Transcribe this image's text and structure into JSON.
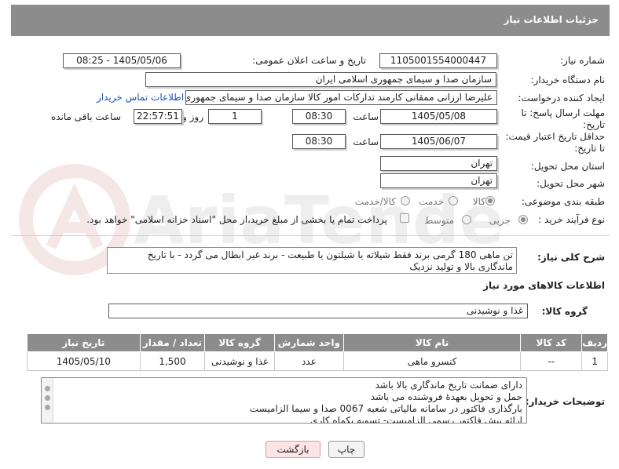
{
  "page": {
    "title": "جزئیات اطلاعات نیاز"
  },
  "fields": {
    "need_number": {
      "label": "شماره نیاز:",
      "value": "1105001554000447"
    },
    "announce_date": {
      "label": "تاریخ و ساعت اعلان عمومی:",
      "value": "1405/05/06 - 08:25"
    },
    "buyer_org": {
      "label": "نام دستگاه خریدار:",
      "value": "سازمان صدا و سیمای جمهوری اسلامی ایران"
    },
    "requester": {
      "label": "ایجاد کننده درخواست:",
      "value": "علیرضا ارزانی ممقانی کارمند تدارکات امور کالا سازمان صدا و سیمای جمهوری ا",
      "link": "اطلاعات تماس خریدار"
    },
    "reply_deadline": {
      "label_line1": "مهلت ارسال پاسخ: تا",
      "label_line2": "تاریخ:",
      "date": "1405/05/08",
      "time_label": "ساعت",
      "time": "08:30",
      "days": "1",
      "days_label": "روز و",
      "remaining": "22:57:51",
      "remaining_label": "ساعت باقی مانده"
    },
    "price_validity": {
      "label_line1": "حداقل تاریخ اعتبار قیمت:",
      "label_line2": "تا تاریخ:",
      "date": "1405/06/07",
      "time_label": "ساعت",
      "time": "08:30"
    },
    "delivery_province": {
      "label": "استان محل تحویل:",
      "value": "تهران"
    },
    "delivery_city": {
      "label": "شهر محل تحویل:",
      "value": "تهران"
    },
    "category": {
      "label": "طبقه بندی موضوعی:",
      "options": [
        "کالا",
        "خدمت",
        "کالا/خدمت"
      ],
      "selected": "کالا"
    },
    "process_type": {
      "label": "نوع فرآیند خرید :",
      "options": [
        "جزیی",
        "متوسط"
      ],
      "selected": "جزیی",
      "payment_note": "پرداخت تمام یا بخشی از مبلغ خرید،از محل \"اسناد خزانه اسلامی\" خواهد بود."
    }
  },
  "description": {
    "label": "شرح کلی نیاز:",
    "text": "تن ماهی 180 گرمی برند فقط شیلاته یا شیلتون یا طبیعت - برند غیر ابطال می گردد - با تاریخ ماندگاری بالا و تولید نزدیک"
  },
  "goods_section": {
    "title": "اطلاعات کالاهای مورد نیاز",
    "group_label": "گروه کالا:",
    "group_value": "غذا و نوشیدنی"
  },
  "goods_table": {
    "headers": [
      "ردیف",
      "کد کالا",
      "نام کالا",
      "واحد شمارش",
      "گروه کالا",
      "تعداد / مقدار",
      "تاریخ نیاز"
    ],
    "rows": [
      {
        "row": "1",
        "code": "--",
        "name": "کنسرو ماهی",
        "unit": "عدد",
        "group": "غذا و نوشیدنی",
        "qty": "1,500",
        "date": "1405/05/10"
      }
    ]
  },
  "buyer_notes": {
    "label": "توضیحات خریدار:",
    "lines": [
      "دارای ضمانت تاریخ ماندگاری بالا باشد",
      "حمل و تحویل بعهدهٔ فروشنده می باشد",
      "بارگذاری فاکتور در سامانه مالیاتی شعبه 0067 صدا و سیما الزامیست",
      "ارائه پیش فاکتور رسمی الزامیست- تسویه یکماه کاری"
    ]
  },
  "buttons": {
    "print": "چاپ",
    "back": "بازگشت"
  },
  "watermark": {
    "text": "AriaTender.net"
  },
  "colors": {
    "header": "#8c8c8c",
    "link": "#1a56b8",
    "back_bg": "#fde5e5",
    "back_border": "#d99a9a"
  }
}
